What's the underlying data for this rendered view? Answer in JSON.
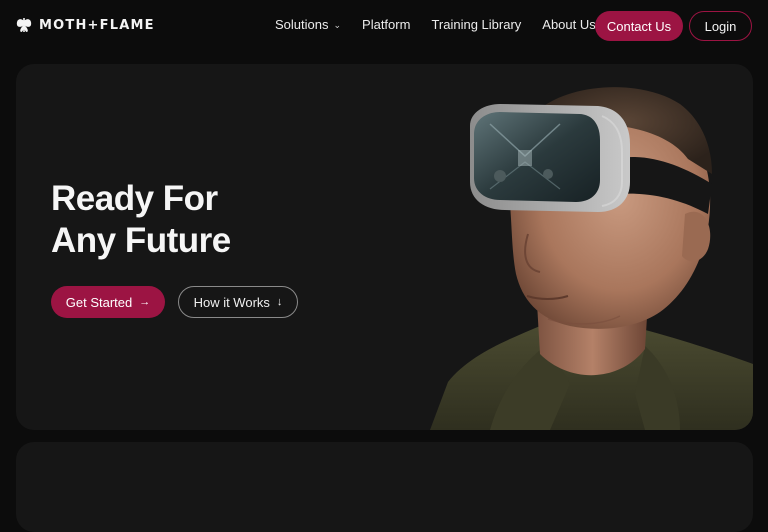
{
  "brand": {
    "name": "MOTH+FLAME",
    "logo_icon": "moth-icon"
  },
  "nav": {
    "items": [
      {
        "label": "Solutions",
        "has_dropdown": true,
        "dropdown_icon": "chevron-down-icon"
      },
      {
        "label": "Platform"
      },
      {
        "label": "Training Library"
      },
      {
        "label": "About Us"
      }
    ],
    "contact_label": "Contact Us",
    "login_label": "Login"
  },
  "hero": {
    "title_line1": "Ready For",
    "title_line2": "Any Future",
    "primary_cta": {
      "label": "Get Started",
      "icon": "arrow-right-icon",
      "glyph": "→"
    },
    "secondary_cta": {
      "label": "How it Works",
      "icon": "arrow-down-icon",
      "glyph": "↓"
    },
    "image_alt": "man-wearing-vr-headset-photo"
  },
  "colors": {
    "page_bg": "#0c0c0c",
    "card_bg": "#161616",
    "accent": "#9c1443",
    "text": "#f3f3f3"
  }
}
